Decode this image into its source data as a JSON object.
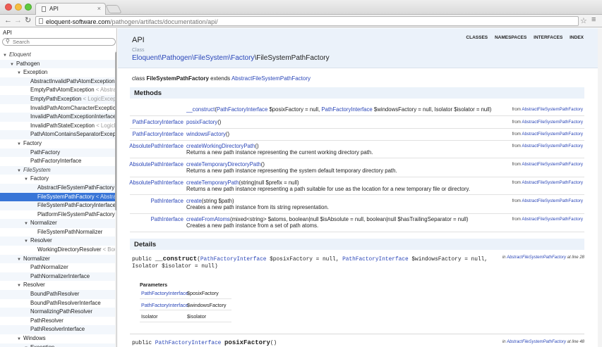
{
  "browser": {
    "tab_title": "API",
    "url_host": "eloquent-software.com",
    "url_path": "/pathogen/artifacts/documentation/api/"
  },
  "sidebar": {
    "title": "API",
    "search_placeholder": "Search",
    "tree": [
      {
        "label": "Eloquent",
        "depth": 0,
        "toggle": "▼",
        "kind": "ns"
      },
      {
        "label": "Pathogen",
        "depth": 1,
        "toggle": "▼"
      },
      {
        "label": "Exception",
        "depth": 2,
        "toggle": "▼"
      },
      {
        "label": "AbstractInvalidPathAtomException",
        "ghost": " < Inval",
        "depth": 3
      },
      {
        "label": "EmptyPathAtomException",
        "ghost": " < AbstractI",
        "depth": 3
      },
      {
        "label": "EmptyPathException",
        "ghost": " < LogicExcepti",
        "depth": 3
      },
      {
        "label": "InvalidPathAtomCharacterException",
        "ghost": " < A",
        "depth": 3
      },
      {
        "label": "InvalidPathAtomExceptionInterface",
        "depth": 3
      },
      {
        "label": "InvalidPathStateException",
        "ghost": " < LogicExc",
        "depth": 3
      },
      {
        "label": "PathAtomContainsSeparatorException",
        "depth": 3
      },
      {
        "label": "Factory",
        "depth": 2,
        "toggle": "▼"
      },
      {
        "label": "PathFactory",
        "depth": 3
      },
      {
        "label": "PathFactoryInterface",
        "depth": 3
      },
      {
        "label": "FileSystem",
        "depth": 2,
        "toggle": "▼",
        "kind": "ns"
      },
      {
        "label": "Factory",
        "depth": 3,
        "toggle": "▼"
      },
      {
        "label": "AbstractFileSystemPathFactory",
        "depth": 4
      },
      {
        "label": "FileSystemPathFactory",
        "ghost": " < Abstract",
        "depth": 4,
        "selected": true
      },
      {
        "label": "FileSystemPathFactoryInterface",
        "depth": 4
      },
      {
        "label": "PlatformFileSystemPathFactory",
        "ghost": " < A",
        "depth": 4
      },
      {
        "label": "Normalizer",
        "depth": 3,
        "toggle": "▼"
      },
      {
        "label": "FileSystemPathNormalizer",
        "depth": 4
      },
      {
        "label": "Resolver",
        "depth": 3,
        "toggle": "▼"
      },
      {
        "label": "WorkingDirectoryResolver",
        "ghost": " < Bound",
        "depth": 4
      },
      {
        "label": "Normalizer",
        "depth": 2,
        "toggle": "▼"
      },
      {
        "label": "PathNormalizer",
        "depth": 3
      },
      {
        "label": "PathNormalizerInterface",
        "depth": 3
      },
      {
        "label": "Resolver",
        "depth": 2,
        "toggle": "▼"
      },
      {
        "label": "BoundPathResolver",
        "depth": 3
      },
      {
        "label": "BoundPathResolverInterface",
        "depth": 3
      },
      {
        "label": "NormalizingPathResolver",
        "depth": 3
      },
      {
        "label": "PathResolver",
        "depth": 3
      },
      {
        "label": "PathResolverInterface",
        "depth": 3
      },
      {
        "label": "Windows",
        "depth": 2,
        "toggle": "▼"
      },
      {
        "label": "Exception",
        "depth": 3,
        "toggle": "▼"
      }
    ]
  },
  "header": {
    "title": "API",
    "nav": [
      "CLASSES",
      "NAMESPACES",
      "INTERFACES",
      "INDEX"
    ],
    "crumb_label": "Class",
    "crumb_ns": "Eloquent\\Pathogen\\FileSystem\\Factory",
    "crumb_class": "\\FileSystemPathFactory"
  },
  "declaration": {
    "prefix": "class ",
    "name": "FileSystemPathFactory",
    "mid": " extends ",
    "parent": "AbstractFileSystemPathFactory"
  },
  "methods": {
    "heading": "Methods",
    "rows": [
      {
        "ret": "",
        "name": "__construct",
        "args_html": "(<span class=\"lnk\">PathFactoryInterface</span> $posixFactory = null, <span class=\"lnk\">PathFactoryInterface</span> $windowsFactory = null, Isolator $isolator = null)",
        "desc": "",
        "from": "AbstractFileSystemPathFactory"
      },
      {
        "ret": "PathFactoryInterface",
        "name": "posixFactory",
        "args_html": "()",
        "desc": "",
        "from": "AbstractFileSystemPathFactory"
      },
      {
        "ret": "PathFactoryInterface",
        "name": "windowsFactory",
        "args_html": "()",
        "desc": "",
        "from": "AbstractFileSystemPathFactory"
      },
      {
        "ret": "AbsolutePathInterface",
        "name": "createWorkingDirectoryPath",
        "args_html": "()",
        "desc": "Returns a new path instance representing the current working directory path.",
        "from": "AbstractFileSystemPathFactory"
      },
      {
        "ret": "AbsolutePathInterface",
        "name": "createTemporaryDirectoryPath",
        "args_html": "()",
        "desc": "Returns a new path instance representing the system default temporary directory path.",
        "from": "AbstractFileSystemPathFactory"
      },
      {
        "ret": "AbsolutePathInterface",
        "name": "createTemporaryPath",
        "args_html": "(string|null $prefix = null)",
        "desc": "Returns a new path instance representing a path suitable for use as the location for a new temporary file or directory.",
        "from": "AbstractFileSystemPathFactory"
      },
      {
        "ret": "PathInterface",
        "name": "create",
        "args_html": "(string $path)",
        "desc": "Creates a new path instance from its string representation.",
        "from": "AbstractFileSystemPathFactory"
      },
      {
        "ret": "PathInterface",
        "name": "createFromAtoms",
        "args_html": "(mixed&lt;string&gt; $atoms, boolean|null $isAbsolute = null, boolean|null $hasTrailingSeparator = null)",
        "desc": "Creates a new path instance from a set of path atoms.",
        "from": "AbstractFileSystemPathFactory"
      }
    ],
    "from_prefix": "from "
  },
  "details": {
    "heading": "Details",
    "construct_sig_pre": "public ",
    "construct_name": "__construct",
    "construct_args_1": "(",
    "construct_type_1": "PathFactoryInterface",
    "construct_args_2": " $posixFactory = null, ",
    "construct_type_2": "PathFactoryInterface",
    "construct_args_3": " $windowsFactory = null, Isolator $isolator = null)",
    "in_prefix": "in ",
    "in_class": "AbstractFileSystemPathFactory",
    "at_line_1": " at line 28",
    "params_title": "Parameters",
    "params": [
      {
        "type": "PathFactoryInterface",
        "name": "$posixFactory",
        "link": true
      },
      {
        "type": "PathFactoryInterface",
        "name": "$windowsFactory",
        "link": true
      },
      {
        "type": "Isolator",
        "name": "$isolator",
        "link": false
      }
    ],
    "posix_sig_pre": "public ",
    "posix_type": "PathFactoryInterface",
    "posix_name": "posixFactory",
    "posix_args": "()",
    "at_line_2": " at line 48"
  }
}
